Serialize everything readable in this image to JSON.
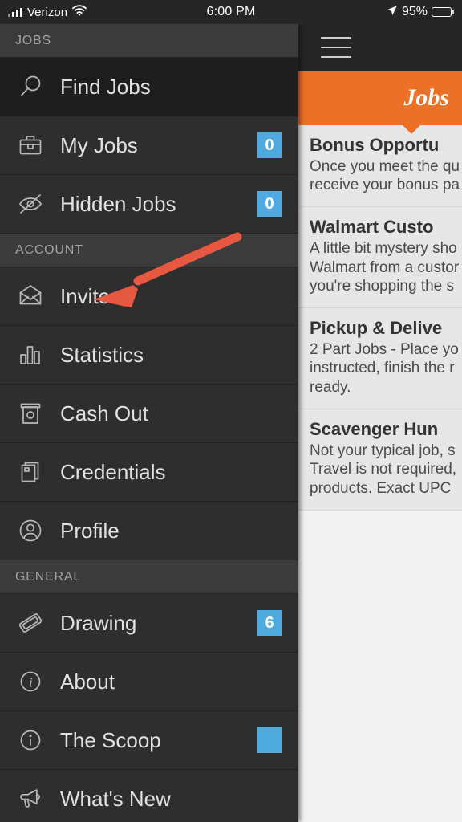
{
  "status_bar": {
    "carrier": "Verizon",
    "signal_icon": "signal-bars-icon",
    "wifi_icon": "wifi-icon",
    "time": "6:00 PM",
    "location_icon": "location-arrow-icon",
    "battery_percent": "95%",
    "battery_icon": "battery-icon",
    "battery_level": 95
  },
  "content": {
    "menu_icon": "hamburger-menu-icon",
    "header_title": "Jobs",
    "header_color": "#ed7027",
    "cards": [
      {
        "title": "Bonus Opportu",
        "body": "Once you meet the qu\nreceive your bonus pa"
      },
      {
        "title": "Walmart Custo",
        "body": "A little bit mystery sho\nWalmart from a custor\nyou're shopping the s"
      },
      {
        "title": "Pickup & Delive",
        "body": "2 Part Jobs - Place yo\ninstructed, finish the r\nready."
      },
      {
        "title": "Scavenger Hun",
        "body": "Not your typical job, s\nTravel is not required,\nproducts. Exact UPC"
      }
    ]
  },
  "drawer": {
    "badge_color": "#50a9dd",
    "sections": [
      {
        "header": "JOBS",
        "items": [
          {
            "label": "Find Jobs",
            "icon": "search-icon",
            "badge": null,
            "active": true
          },
          {
            "label": "My Jobs",
            "icon": "briefcase-icon",
            "badge": "0",
            "active": false
          },
          {
            "label": "Hidden Jobs",
            "icon": "eye-slash-icon",
            "badge": "0",
            "active": false
          }
        ]
      },
      {
        "header": "ACCOUNT",
        "items": [
          {
            "label": "Invite",
            "icon": "envelope-icon",
            "badge": null,
            "active": false
          },
          {
            "label": "Statistics",
            "icon": "bar-chart-icon",
            "badge": null,
            "active": false
          },
          {
            "label": "Cash Out",
            "icon": "cash-dispenser-icon",
            "badge": null,
            "active": false
          },
          {
            "label": "Credentials",
            "icon": "documents-icon",
            "badge": null,
            "active": false
          },
          {
            "label": "Profile",
            "icon": "user-circle-icon",
            "badge": null,
            "active": false
          }
        ]
      },
      {
        "header": "GENERAL",
        "items": [
          {
            "label": "Drawing",
            "icon": "ticket-icon",
            "badge": "6",
            "active": false
          },
          {
            "label": "About",
            "icon": "info-italic-icon",
            "badge": null,
            "active": false
          },
          {
            "label": "The Scoop",
            "icon": "info-circle-icon",
            "badge": "",
            "active": false
          },
          {
            "label": "What's New",
            "icon": "megaphone-icon",
            "badge": null,
            "active": false
          }
        ]
      }
    ]
  },
  "annotation": {
    "arrow_color": "#e8573f",
    "points_to": "Invite"
  }
}
